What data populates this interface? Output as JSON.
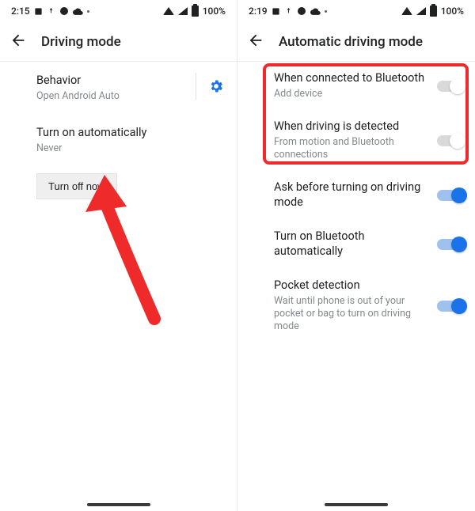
{
  "left": {
    "status": {
      "time": "2:15",
      "battery": "100%"
    },
    "header": {
      "title": "Driving mode"
    },
    "behavior": {
      "title": "Behavior",
      "subtitle": "Open Android Auto"
    },
    "auto": {
      "title": "Turn on automatically",
      "subtitle": "Never"
    },
    "turn_off_btn": "Turn off now"
  },
  "right": {
    "status": {
      "time": "2:19",
      "battery": "100%"
    },
    "header": {
      "title": "Automatic driving mode"
    },
    "items": [
      {
        "title": "When connected to Bluetooth",
        "subtitle": "Add device",
        "on": false
      },
      {
        "title": "When driving is detected",
        "subtitle": "From motion and Bluetooth connections",
        "on": false
      },
      {
        "title": "Ask before turning on driving mode",
        "subtitle": "",
        "on": true
      },
      {
        "title": "Turn on Bluetooth automatically",
        "subtitle": "",
        "on": true
      },
      {
        "title": "Pocket detection",
        "subtitle": "Wait until phone is out of your pocket or bag to turn on driving mode",
        "on": true
      }
    ]
  }
}
